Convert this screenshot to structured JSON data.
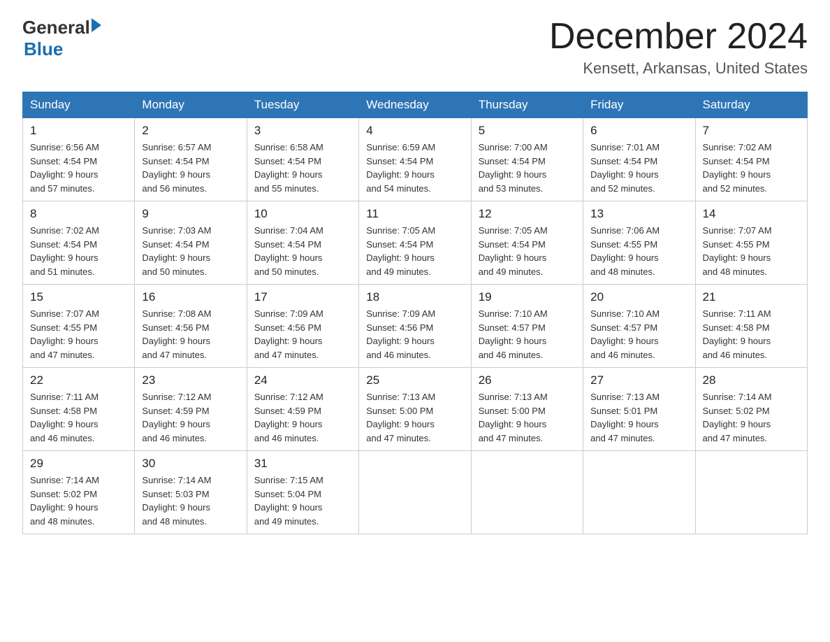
{
  "header": {
    "logo_general": "General",
    "logo_blue": "Blue",
    "month_title": "December 2024",
    "location": "Kensett, Arkansas, United States"
  },
  "weekdays": [
    "Sunday",
    "Monday",
    "Tuesday",
    "Wednesday",
    "Thursday",
    "Friday",
    "Saturday"
  ],
  "weeks": [
    [
      {
        "day": "1",
        "sunrise": "6:56 AM",
        "sunset": "4:54 PM",
        "daylight": "9 hours and 57 minutes."
      },
      {
        "day": "2",
        "sunrise": "6:57 AM",
        "sunset": "4:54 PM",
        "daylight": "9 hours and 56 minutes."
      },
      {
        "day": "3",
        "sunrise": "6:58 AM",
        "sunset": "4:54 PM",
        "daylight": "9 hours and 55 minutes."
      },
      {
        "day": "4",
        "sunrise": "6:59 AM",
        "sunset": "4:54 PM",
        "daylight": "9 hours and 54 minutes."
      },
      {
        "day": "5",
        "sunrise": "7:00 AM",
        "sunset": "4:54 PM",
        "daylight": "9 hours and 53 minutes."
      },
      {
        "day": "6",
        "sunrise": "7:01 AM",
        "sunset": "4:54 PM",
        "daylight": "9 hours and 52 minutes."
      },
      {
        "day": "7",
        "sunrise": "7:02 AM",
        "sunset": "4:54 PM",
        "daylight": "9 hours and 52 minutes."
      }
    ],
    [
      {
        "day": "8",
        "sunrise": "7:02 AM",
        "sunset": "4:54 PM",
        "daylight": "9 hours and 51 minutes."
      },
      {
        "day": "9",
        "sunrise": "7:03 AM",
        "sunset": "4:54 PM",
        "daylight": "9 hours and 50 minutes."
      },
      {
        "day": "10",
        "sunrise": "7:04 AM",
        "sunset": "4:54 PM",
        "daylight": "9 hours and 50 minutes."
      },
      {
        "day": "11",
        "sunrise": "7:05 AM",
        "sunset": "4:54 PM",
        "daylight": "9 hours and 49 minutes."
      },
      {
        "day": "12",
        "sunrise": "7:05 AM",
        "sunset": "4:54 PM",
        "daylight": "9 hours and 49 minutes."
      },
      {
        "day": "13",
        "sunrise": "7:06 AM",
        "sunset": "4:55 PM",
        "daylight": "9 hours and 48 minutes."
      },
      {
        "day": "14",
        "sunrise": "7:07 AM",
        "sunset": "4:55 PM",
        "daylight": "9 hours and 48 minutes."
      }
    ],
    [
      {
        "day": "15",
        "sunrise": "7:07 AM",
        "sunset": "4:55 PM",
        "daylight": "9 hours and 47 minutes."
      },
      {
        "day": "16",
        "sunrise": "7:08 AM",
        "sunset": "4:56 PM",
        "daylight": "9 hours and 47 minutes."
      },
      {
        "day": "17",
        "sunrise": "7:09 AM",
        "sunset": "4:56 PM",
        "daylight": "9 hours and 47 minutes."
      },
      {
        "day": "18",
        "sunrise": "7:09 AM",
        "sunset": "4:56 PM",
        "daylight": "9 hours and 46 minutes."
      },
      {
        "day": "19",
        "sunrise": "7:10 AM",
        "sunset": "4:57 PM",
        "daylight": "9 hours and 46 minutes."
      },
      {
        "day": "20",
        "sunrise": "7:10 AM",
        "sunset": "4:57 PM",
        "daylight": "9 hours and 46 minutes."
      },
      {
        "day": "21",
        "sunrise": "7:11 AM",
        "sunset": "4:58 PM",
        "daylight": "9 hours and 46 minutes."
      }
    ],
    [
      {
        "day": "22",
        "sunrise": "7:11 AM",
        "sunset": "4:58 PM",
        "daylight": "9 hours and 46 minutes."
      },
      {
        "day": "23",
        "sunrise": "7:12 AM",
        "sunset": "4:59 PM",
        "daylight": "9 hours and 46 minutes."
      },
      {
        "day": "24",
        "sunrise": "7:12 AM",
        "sunset": "4:59 PM",
        "daylight": "9 hours and 46 minutes."
      },
      {
        "day": "25",
        "sunrise": "7:13 AM",
        "sunset": "5:00 PM",
        "daylight": "9 hours and 47 minutes."
      },
      {
        "day": "26",
        "sunrise": "7:13 AM",
        "sunset": "5:00 PM",
        "daylight": "9 hours and 47 minutes."
      },
      {
        "day": "27",
        "sunrise": "7:13 AM",
        "sunset": "5:01 PM",
        "daylight": "9 hours and 47 minutes."
      },
      {
        "day": "28",
        "sunrise": "7:14 AM",
        "sunset": "5:02 PM",
        "daylight": "9 hours and 47 minutes."
      }
    ],
    [
      {
        "day": "29",
        "sunrise": "7:14 AM",
        "sunset": "5:02 PM",
        "daylight": "9 hours and 48 minutes."
      },
      {
        "day": "30",
        "sunrise": "7:14 AM",
        "sunset": "5:03 PM",
        "daylight": "9 hours and 48 minutes."
      },
      {
        "day": "31",
        "sunrise": "7:15 AM",
        "sunset": "5:04 PM",
        "daylight": "9 hours and 49 minutes."
      },
      null,
      null,
      null,
      null
    ]
  ],
  "labels": {
    "sunrise": "Sunrise:",
    "sunset": "Sunset:",
    "daylight": "Daylight:"
  }
}
